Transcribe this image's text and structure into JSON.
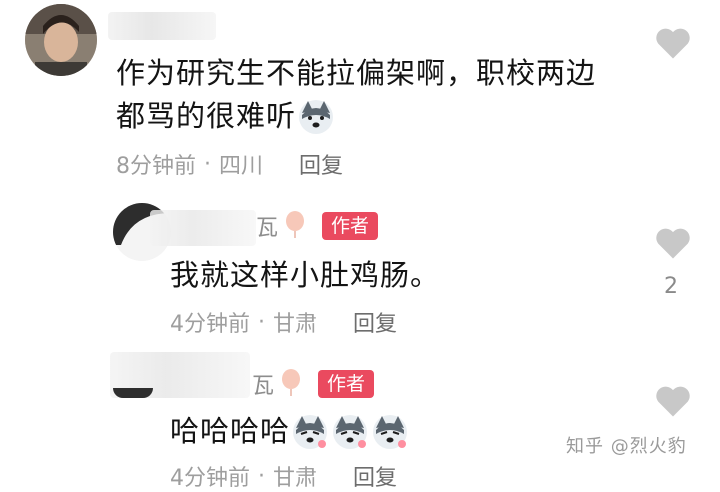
{
  "comment": {
    "text_line1": "作为研究生不能拉偏架啊，职校两边",
    "text_line2": "都骂的很难听",
    "time": "8分钟前",
    "location": "四川",
    "reply_label": "回复",
    "emoji": "husky-emoji"
  },
  "replies": [
    {
      "name_suffix": "瓦",
      "badge": "作者",
      "text": "我就这样小肚鸡肠。",
      "time": "4分钟前",
      "location": "甘肃",
      "reply_label": "回复",
      "like_count": "2"
    },
    {
      "name_suffix": "瓦",
      "badge": "作者",
      "text": "哈哈哈哈",
      "time": "4分钟前",
      "location": "甘肃",
      "reply_label": "回复",
      "emojis": [
        "husky-emoji",
        "husky-emoji",
        "husky-emoji"
      ]
    }
  ],
  "separator": "·",
  "watermark": "知乎 @烈火豹",
  "colors": {
    "badge": "#ea4a5f",
    "heart": "#c8c8c8",
    "meta": "#9e9e9e"
  }
}
